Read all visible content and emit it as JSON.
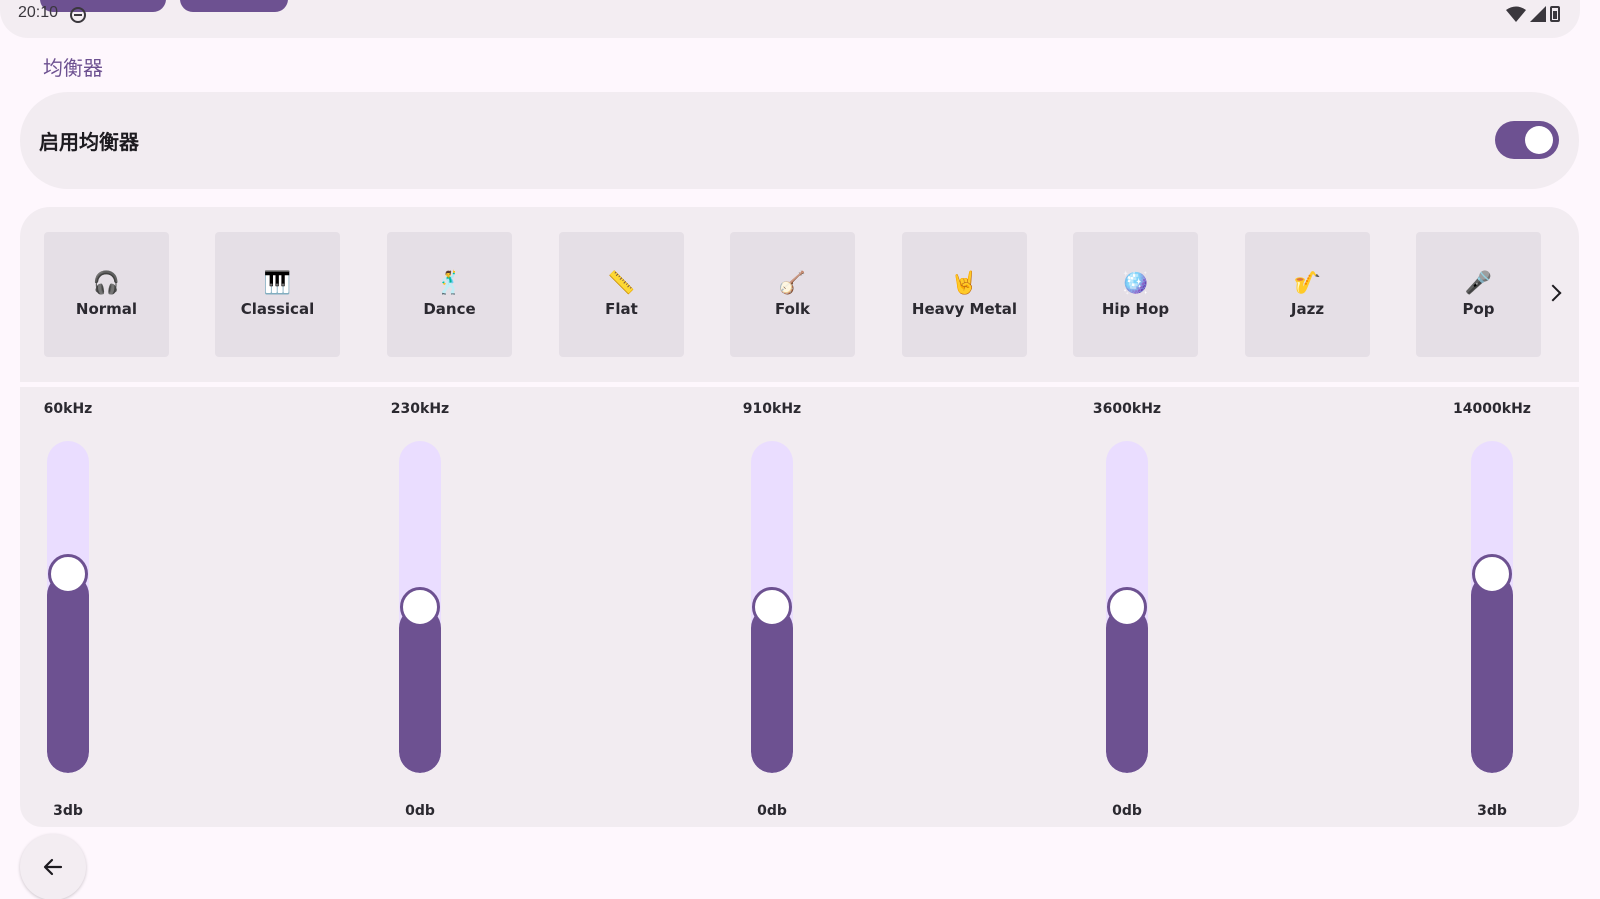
{
  "status_bar": {
    "time": "20:10"
  },
  "section_title": "均衡器",
  "enable": {
    "label": "启用均衡器",
    "enabled": true
  },
  "colors": {
    "accent": "#6D5191",
    "track": "#EADDFF",
    "card": "#F2ECF1",
    "preset_tile": "#E5DFE6",
    "background": "#FEF7FD"
  },
  "presets": [
    {
      "name": "Normal",
      "icon": "headphones-icon",
      "glyph": "🎧"
    },
    {
      "name": "Classical",
      "icon": "piano-icon",
      "glyph": "🎹"
    },
    {
      "name": "Dance",
      "icon": "dancer-icon",
      "glyph": "🕺"
    },
    {
      "name": "Flat",
      "icon": "ruler-icon",
      "glyph": "📏"
    },
    {
      "name": "Folk",
      "icon": "banjo-icon",
      "glyph": "🪕"
    },
    {
      "name": "Heavy Metal",
      "icon": "rock-hand-icon",
      "glyph": "🤘"
    },
    {
      "name": "Hip Hop",
      "icon": "disco-ball-icon",
      "glyph": "🪩"
    },
    {
      "name": "Jazz",
      "icon": "saxophone-icon",
      "glyph": "🎷"
    },
    {
      "name": "Pop",
      "icon": "microphone-icon",
      "glyph": "🎤"
    }
  ],
  "bands": [
    {
      "freq": "60kHz",
      "gain": "3db",
      "level": 0.6
    },
    {
      "freq": "230kHz",
      "gain": "0db",
      "level": 0.5
    },
    {
      "freq": "910kHz",
      "gain": "0db",
      "level": 0.5
    },
    {
      "freq": "3600kHz",
      "gain": "0db",
      "level": 0.5
    },
    {
      "freq": "14000kHz",
      "gain": "3db",
      "level": 0.6
    }
  ]
}
